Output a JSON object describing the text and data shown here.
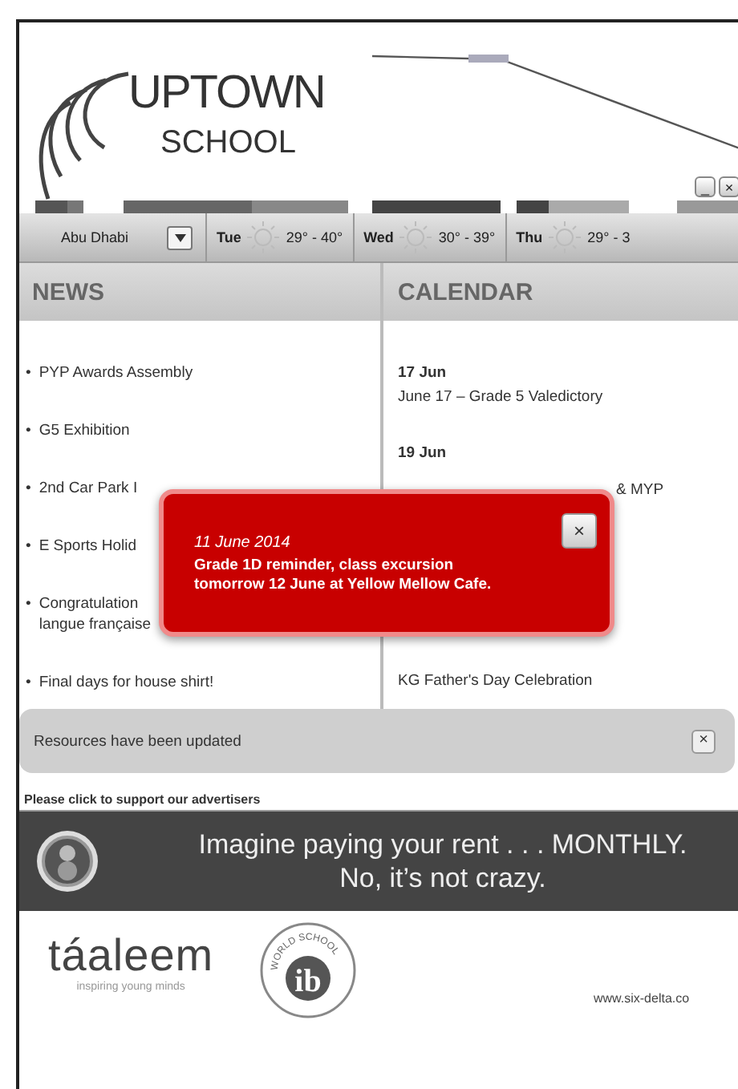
{
  "header": {
    "logo_top": "UPTOWN",
    "logo_bottom": "SCHOOL",
    "window_buttons": [
      "_",
      "×"
    ]
  },
  "weather": {
    "city": "Abu Dhabi",
    "days": [
      {
        "day": "Tue",
        "temp": "29° - 40°"
      },
      {
        "day": "Wed",
        "temp": "30° - 39°"
      },
      {
        "day": "Thu",
        "temp": "29° - 3"
      }
    ]
  },
  "news": {
    "title": "NEWS",
    "items": [
      {
        "bullet": "•",
        "lines": [
          "PYP Awards Assembly"
        ]
      },
      {
        "bullet": "•",
        "lines": [
          "G5 Exhibition"
        ]
      },
      {
        "bullet": "•",
        "lines": [
          "2nd Car Park I"
        ]
      },
      {
        "bullet": "•",
        "lines": [
          "E Sports Holid"
        ]
      },
      {
        "bullet": "•",
        "lines": [
          "Congratulation",
          "langue française"
        ]
      },
      {
        "bullet": "•",
        "lines": [
          "Final days for house shirt!"
        ]
      }
    ]
  },
  "calendar": {
    "title": "CALENDAR",
    "items": [
      {
        "date": "17 Jun",
        "detail": "June 17 – Grade 5 Valedictory",
        "kind": "full"
      },
      {
        "date": "19 Jun",
        "detail": "& MYP",
        "kind": "obscured"
      },
      {
        "detail": "KG Father's Day Celebration",
        "kind": "obscured-date"
      }
    ]
  },
  "popup": {
    "date": "11 June 2014",
    "message": "Grade 1D reminder, class excursion tomorrow 12 June at Yellow Mellow Cafe.",
    "close": "×"
  },
  "notice": {
    "text": "Resources have been updated",
    "close": "×"
  },
  "advertisers": {
    "label": "Please click to support our advertisers",
    "banner_lines": [
      "Imagine paying your rent . . . MONTHLY.",
      "No, it’s not crazy."
    ]
  },
  "footer": {
    "brand": "táaleem",
    "tagline": "inspiring young minds",
    "badge_letters": "ib",
    "badge_ring": "WORLD SCHOOL",
    "credit": "www.six-delta.co"
  }
}
